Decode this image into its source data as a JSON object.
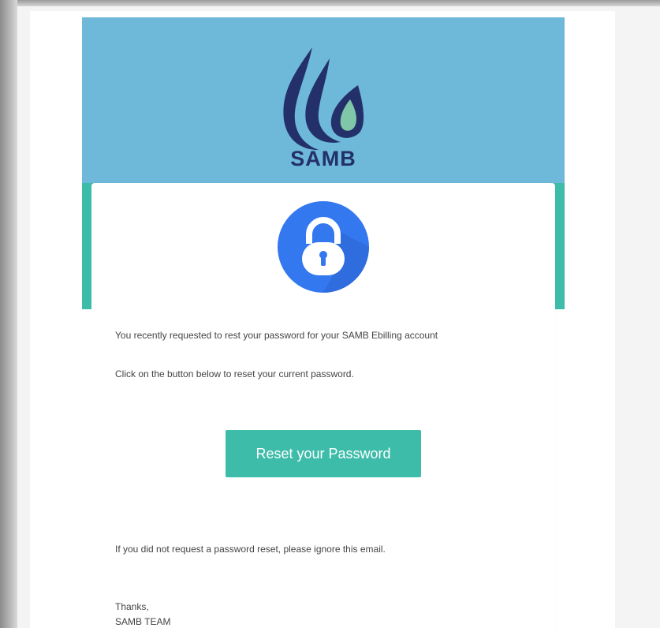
{
  "brand": {
    "name": "SAMB",
    "banner_color": "#6eb9d9",
    "accent_color": "#3dbcaa",
    "logo_icon": "water-drop-logo-icon"
  },
  "hero": {
    "icon": "padlock-icon",
    "icon_color": "#3478f0"
  },
  "email": {
    "line1": "You recently requested to rest your password for your SAMB Ebilling account",
    "line2": "Click on the button below to reset your current password.",
    "button_label": "Reset your Password",
    "ignore_text": "If you did not request a password reset, please ignore this email.",
    "thanks": "Thanks,",
    "signature": "SAMB TEAM"
  }
}
